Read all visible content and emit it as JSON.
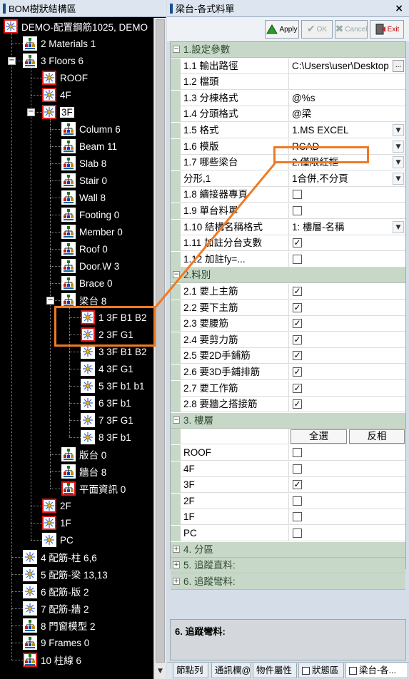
{
  "left_panel": {
    "title": "BOM樹狀結構區",
    "tree": [
      {
        "label": "DEMO-配置鋼筋1025, DEMO",
        "depth": 0,
        "toggle": "",
        "icon": "sparkle",
        "red": true
      },
      {
        "label": "2 Materials 1",
        "depth": 1,
        "toggle": "",
        "icon": "people",
        "red": false
      },
      {
        "label": "3 Floors 6",
        "depth": 1,
        "toggle": "−",
        "icon": "people",
        "red": false
      },
      {
        "label": "ROOF",
        "depth": 2,
        "toggle": "",
        "icon": "sparkle",
        "red": true
      },
      {
        "label": "4F",
        "depth": 2,
        "toggle": "",
        "icon": "sparkle",
        "red": true
      },
      {
        "label": "3F",
        "depth": 2,
        "toggle": "−",
        "icon": "sparkle",
        "red": true,
        "selected": true
      },
      {
        "label": "Column 6",
        "depth": 3,
        "toggle": "",
        "icon": "people",
        "red": false
      },
      {
        "label": "Beam 11",
        "depth": 3,
        "toggle": "",
        "icon": "people",
        "red": false
      },
      {
        "label": "Slab 8",
        "depth": 3,
        "toggle": "",
        "icon": "people",
        "red": false
      },
      {
        "label": "Stair 0",
        "depth": 3,
        "toggle": "",
        "icon": "people",
        "red": false
      },
      {
        "label": "Wall 8",
        "depth": 3,
        "toggle": "",
        "icon": "people",
        "red": false
      },
      {
        "label": "Footing 0",
        "depth": 3,
        "toggle": "",
        "icon": "people",
        "red": false
      },
      {
        "label": "Member 0",
        "depth": 3,
        "toggle": "",
        "icon": "people",
        "red": false
      },
      {
        "label": "Roof 0",
        "depth": 3,
        "toggle": "",
        "icon": "people",
        "red": false
      },
      {
        "label": "Door.W 3",
        "depth": 3,
        "toggle": "",
        "icon": "people",
        "red": false
      },
      {
        "label": "Brace 0",
        "depth": 3,
        "toggle": "",
        "icon": "people",
        "red": false
      },
      {
        "label": "梁台 8",
        "depth": 3,
        "toggle": "−",
        "icon": "people",
        "red": false
      },
      {
        "label": "1 3F B1 B2",
        "depth": 4,
        "toggle": "",
        "icon": "sparkle",
        "red": true
      },
      {
        "label": "2 3F G1",
        "depth": 4,
        "toggle": "",
        "icon": "sparkle",
        "red": true
      },
      {
        "label": "3 3F B1 B2",
        "depth": 4,
        "toggle": "",
        "icon": "sparkle",
        "red": false
      },
      {
        "label": "4 3F G1",
        "depth": 4,
        "toggle": "",
        "icon": "sparkle",
        "red": false
      },
      {
        "label": "5 3F b1 b1",
        "depth": 4,
        "toggle": "",
        "icon": "sparkle",
        "red": false
      },
      {
        "label": "6 3F b1",
        "depth": 4,
        "toggle": "",
        "icon": "sparkle",
        "red": false
      },
      {
        "label": "7 3F G1",
        "depth": 4,
        "toggle": "",
        "icon": "sparkle",
        "red": false
      },
      {
        "label": "8 3F b1",
        "depth": 4,
        "toggle": "",
        "icon": "sparkle",
        "red": false
      },
      {
        "label": "版台 0",
        "depth": 3,
        "toggle": "",
        "icon": "people",
        "red": false
      },
      {
        "label": "牆台 8",
        "depth": 3,
        "toggle": "",
        "icon": "people",
        "red": false
      },
      {
        "label": "平面資訊 0",
        "depth": 3,
        "toggle": "",
        "icon": "people",
        "red": true
      },
      {
        "label": "2F",
        "depth": 2,
        "toggle": "",
        "icon": "sparkle",
        "red": true
      },
      {
        "label": "1F",
        "depth": 2,
        "toggle": "",
        "icon": "sparkle",
        "red": true
      },
      {
        "label": "PC",
        "depth": 2,
        "toggle": "",
        "icon": "sparkle",
        "red": false
      },
      {
        "label": "4 配筋-柱 6,6",
        "depth": 1,
        "toggle": "",
        "icon": "sparkle",
        "red": false
      },
      {
        "label": "5 配筋-梁 13,13",
        "depth": 1,
        "toggle": "",
        "icon": "sparkle",
        "red": false
      },
      {
        "label": "6 配筋-版 2",
        "depth": 1,
        "toggle": "",
        "icon": "sparkle",
        "red": false
      },
      {
        "label": "7 配筋-牆 2",
        "depth": 1,
        "toggle": "",
        "icon": "sparkle",
        "red": false
      },
      {
        "label": "8 門窗模型 2",
        "depth": 1,
        "toggle": "",
        "icon": "people",
        "red": false
      },
      {
        "label": "9 Frames 0",
        "depth": 1,
        "toggle": "",
        "icon": "people",
        "red": false
      },
      {
        "label": "10 柱線 6",
        "depth": 1,
        "toggle": "",
        "icon": "people",
        "red": true
      }
    ]
  },
  "right_panel": {
    "title": "梁台-各式料單",
    "close_icon": "×",
    "toolbar": {
      "apply": "Apply",
      "ok": "OK",
      "cancel": "Cancel",
      "exit": "Exit"
    },
    "sections": [
      {
        "kind": "cat",
        "toggle": "−",
        "label": "1.設定參數"
      },
      {
        "kind": "row",
        "name": "1.1 輸出路徑",
        "value": "C:\\Users\\user\\Desktop",
        "ctrl": "ellipsis"
      },
      {
        "kind": "row",
        "name": "1.2 檔頭",
        "value": "",
        "ctrl": ""
      },
      {
        "kind": "row",
        "name": "1.3 分棟格式",
        "value": "@%s",
        "ctrl": ""
      },
      {
        "kind": "row",
        "name": "1.4 分頭格式",
        "value": "@梁",
        "ctrl": ""
      },
      {
        "kind": "row",
        "name": "1.5 格式",
        "value": "1.MS EXCEL",
        "ctrl": "dropdown"
      },
      {
        "kind": "row",
        "name": "1.6 模版",
        "value": "RCAD",
        "ctrl": "dropdown"
      },
      {
        "kind": "row",
        "name": "1.7 哪些梁台",
        "value": "2.僅限紅框",
        "ctrl": "dropdown"
      },
      {
        "kind": "row",
        "name": "分形,1",
        "value": "1合併,不分頁",
        "ctrl": "dropdown"
      },
      {
        "kind": "row",
        "name": "1.8 續接器專頁",
        "value": "",
        "ctrl": "check",
        "checked": false
      },
      {
        "kind": "row",
        "name": "1.9 單台料單",
        "value": "",
        "ctrl": "check",
        "checked": false
      },
      {
        "kind": "row",
        "name": "1.10 結構名稱格式",
        "value": "1: 樓層-名稱",
        "ctrl": "dropdown"
      },
      {
        "kind": "row",
        "name": "1.11 加註分台支數",
        "value": "",
        "ctrl": "check",
        "checked": true
      },
      {
        "kind": "row",
        "name": "1.12 加註fy=...",
        "value": "",
        "ctrl": "check",
        "checked": false
      },
      {
        "kind": "cat",
        "toggle": "−",
        "label": "2.料別"
      },
      {
        "kind": "row",
        "name": "2.1 要上主筋",
        "value": "",
        "ctrl": "check",
        "checked": true
      },
      {
        "kind": "row",
        "name": "2.2 要下主筋",
        "value": "",
        "ctrl": "check",
        "checked": true
      },
      {
        "kind": "row",
        "name": "2.3 要腰筋",
        "value": "",
        "ctrl": "check",
        "checked": true
      },
      {
        "kind": "row",
        "name": "2.4 要剪力筋",
        "value": "",
        "ctrl": "check",
        "checked": true
      },
      {
        "kind": "row",
        "name": "2.5 要2D手鋪筋",
        "value": "",
        "ctrl": "check",
        "checked": true
      },
      {
        "kind": "row",
        "name": "2.6 要3D手鋪排筋",
        "value": "",
        "ctrl": "check",
        "checked": true
      },
      {
        "kind": "row",
        "name": "2.7 要工作筋",
        "value": "",
        "ctrl": "check",
        "checked": true
      },
      {
        "kind": "row",
        "name": "2.8 要牆之搭接筋",
        "value": "",
        "ctrl": "check",
        "checked": true
      },
      {
        "kind": "cat",
        "toggle": "−",
        "label": "3. 樓層"
      },
      {
        "kind": "buttons",
        "b1": "全選",
        "b2": "反相"
      },
      {
        "kind": "row",
        "name": "ROOF",
        "value": "",
        "ctrl": "check",
        "checked": false
      },
      {
        "kind": "row",
        "name": "4F",
        "value": "",
        "ctrl": "check",
        "checked": false
      },
      {
        "kind": "row",
        "name": "3F",
        "value": "",
        "ctrl": "check",
        "checked": true
      },
      {
        "kind": "row",
        "name": "2F",
        "value": "",
        "ctrl": "check",
        "checked": false
      },
      {
        "kind": "row",
        "name": "1F",
        "value": "",
        "ctrl": "check",
        "checked": false
      },
      {
        "kind": "row",
        "name": "PC",
        "value": "",
        "ctrl": "check",
        "checked": false
      },
      {
        "kind": "cat",
        "toggle": "+",
        "label": "4. 分區"
      },
      {
        "kind": "cat",
        "toggle": "+",
        "label": "5. 追蹤直料:"
      },
      {
        "kind": "cat",
        "toggle": "+",
        "label": "6. 追蹤彎料:"
      }
    ],
    "description": "6. 追蹤彎料:",
    "tabs": [
      "節點列",
      "通訊欄@",
      "物件屬性",
      "狀態區",
      "梁台-各..."
    ]
  },
  "colors": {
    "highlight": "#f07a22",
    "icon_border": "#e01818",
    "category_bg": "#c8d8c8",
    "tree_bg": "#000000"
  }
}
